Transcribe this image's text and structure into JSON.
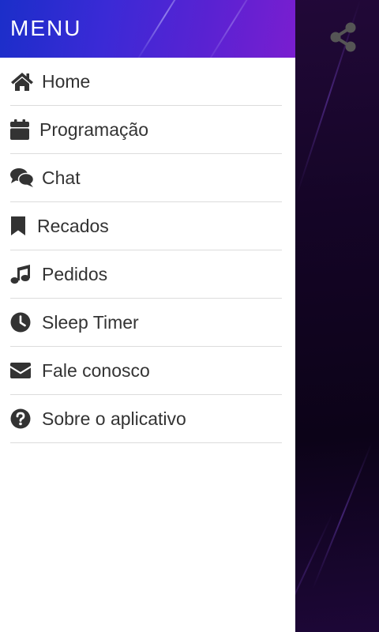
{
  "drawer": {
    "title": "MENU",
    "items": [
      {
        "label": "Home",
        "icon": "home-icon"
      },
      {
        "label": "Programação",
        "icon": "calendar-icon"
      },
      {
        "label": "Chat",
        "icon": "chat-icon"
      },
      {
        "label": "Recados",
        "icon": "bookmark-icon"
      },
      {
        "label": "Pedidos",
        "icon": "music-note-icon"
      },
      {
        "label": "Sleep Timer",
        "icon": "clock-icon"
      },
      {
        "label": "Fale conosco",
        "icon": "envelope-icon"
      },
      {
        "label": "Sobre o aplicativo",
        "icon": "question-circle-icon"
      }
    ]
  },
  "toolbar": {
    "share_icon": "share-icon"
  },
  "colors": {
    "header_gradient_start": "#1b2ec9",
    "header_gradient_end": "#7a1ed0",
    "background_dark": "#150527",
    "icon_color": "#333333",
    "share_icon_color": "#555555"
  }
}
